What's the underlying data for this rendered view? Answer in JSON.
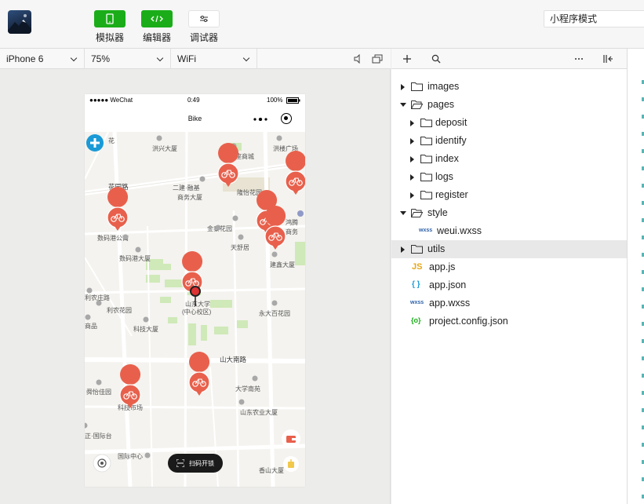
{
  "toolbar": {
    "simulator_label": "模拟器",
    "editor_label": "编辑器",
    "debugger_label": "调试器",
    "mode_label": "小程序模式"
  },
  "subbar": {
    "device": "iPhone 6",
    "zoom": "75%",
    "network": "WiFi"
  },
  "phone": {
    "status_left": "●●●●● WeChat",
    "status_time": "0:49",
    "status_battery": "100%",
    "nav_title": "Bike",
    "scan_label": "扫码开锁",
    "map_labels": {
      "huaxi": "花",
      "hongxing": "洪兴大厦",
      "yinzuo": "银座商城",
      "hongmian": "洪楼广场",
      "huayuanlu": "花园路",
      "erjian": "二建·融基",
      "erjian2": "商务大厦",
      "longyi": "隆怡花园",
      "jinchun": "金泰花园",
      "hongteng": "鸿腾",
      "hongteng2": "商务",
      "shuma": "数码港公寓",
      "shuma2": "数码港大厦",
      "tianyu": "天舒居",
      "jianxin": "建鑫大厦",
      "lixin": "利农庄路",
      "lixin2": "利农花园",
      "shangpin": "商品",
      "shanda": "山东大学",
      "shanda2": "(中心校区)",
      "keji": "科技大厦",
      "yongda": "永大百花园",
      "shandananlu": "山大南路",
      "shuyuan": "舜怡佳园",
      "daxue": "大学南苑",
      "keji2": "科技市场",
      "nongye": "山东农业大厦",
      "guoji": "国际中心",
      "xiangbai": "香山大厦",
      "zheng": "正·国际台"
    }
  },
  "tree": {
    "items": [
      {
        "name": "images"
      },
      {
        "name": "pages"
      },
      {
        "name": "deposit"
      },
      {
        "name": "identify"
      },
      {
        "name": "index"
      },
      {
        "name": "logs"
      },
      {
        "name": "register"
      },
      {
        "name": "style"
      },
      {
        "name": "weui.wxss"
      },
      {
        "name": "utils"
      },
      {
        "name": "app.js"
      },
      {
        "name": "app.json"
      },
      {
        "name": "app.wxss"
      },
      {
        "name": "project.config.json"
      }
    ]
  },
  "colors": {
    "wechat_green": "#1aad19",
    "bike_pin": "#e8604c",
    "selected_row": "#e8e8e8",
    "js_icon": "#e6a817",
    "json_icon": "#1a9ad6",
    "config_icon": "#1aad19",
    "wxss_icon": "#2b5fa8"
  }
}
